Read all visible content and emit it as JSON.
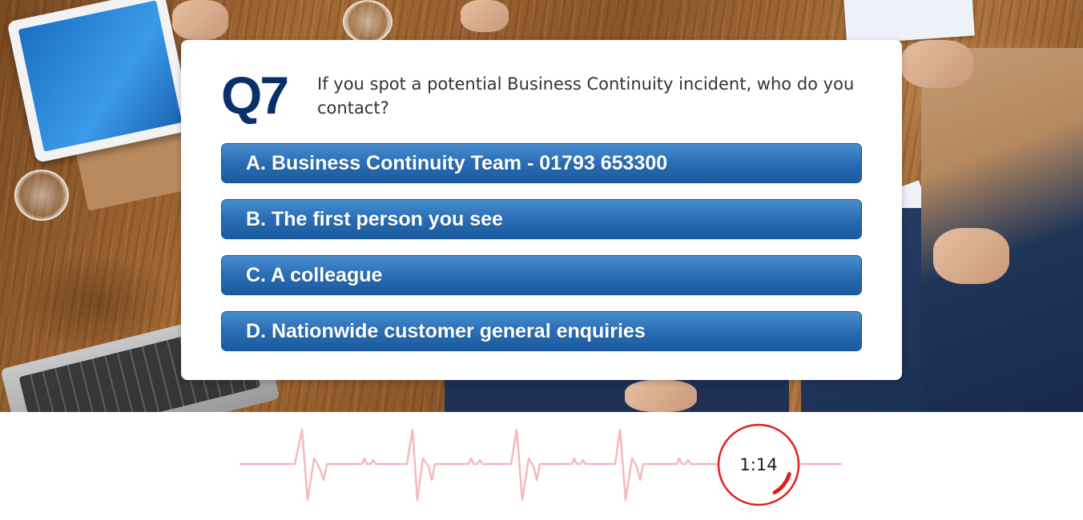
{
  "question": {
    "number": "Q7",
    "text": "If you spot a potential Business Continuity incident, who do you contact?"
  },
  "answers": [
    {
      "label": "A. Business Continuity Team - 01793 653300"
    },
    {
      "label": "B. The first person you see"
    },
    {
      "label": "C. A colleague"
    },
    {
      "label": "D. Nationwide customer general enquiries"
    }
  ],
  "timer": {
    "display": "1:14",
    "progress_fraction": 0.12,
    "color": "#e02020",
    "line_color": "#f6b8bf"
  },
  "colors": {
    "question_number": "#0b2f6b",
    "answer_button": "#2c6fb6"
  }
}
